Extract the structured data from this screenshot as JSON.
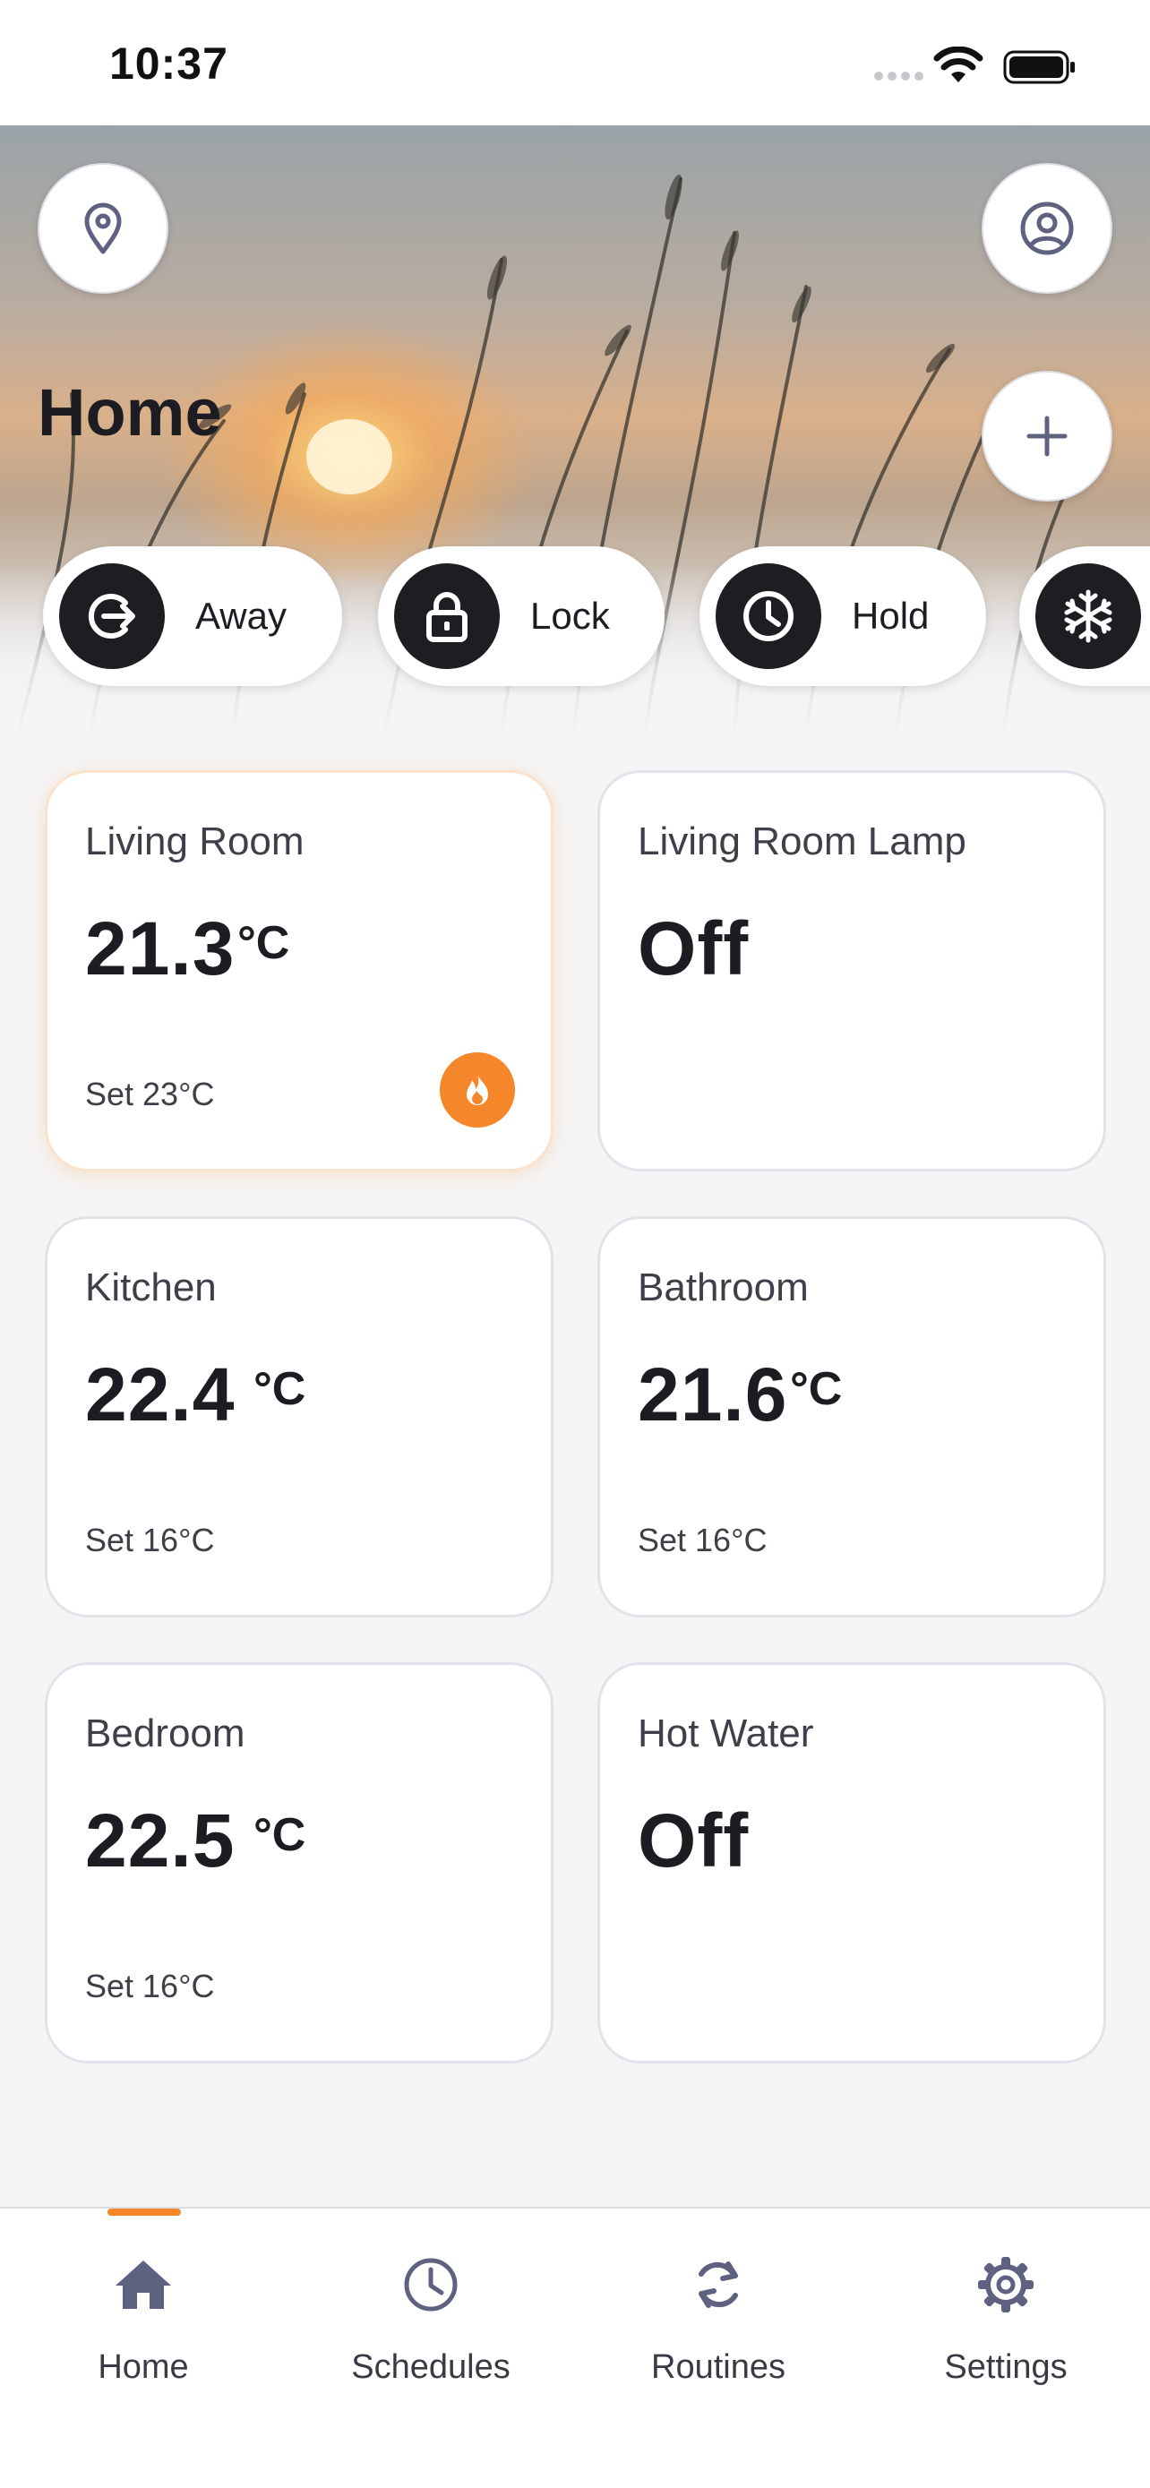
{
  "status_bar": {
    "time": "10:37"
  },
  "header": {
    "title": "Home",
    "location_icon": "location-pin-icon",
    "profile_icon": "user-circle-icon",
    "add_icon": "plus-icon"
  },
  "modes": [
    {
      "label": "Away",
      "icon": "exit-arrow-icon"
    },
    {
      "label": "Lock",
      "icon": "padlock-icon"
    },
    {
      "label": "Hold",
      "icon": "clock-icon"
    },
    {
      "label": "",
      "icon": "snowflake-icon"
    }
  ],
  "rooms": [
    {
      "name": "Living Room",
      "value": "21.3",
      "unit": "°C",
      "setpoint": "Set 23°C",
      "heating": true
    },
    {
      "name": "Living Room Lamp",
      "value": "Off",
      "unit": "",
      "setpoint": "",
      "heating": false
    },
    {
      "name": "Kitchen",
      "value": "22.4",
      "unit": "°C",
      "setpoint": "Set 16°C",
      "heating": false
    },
    {
      "name": "Bathroom",
      "value": "21.6",
      "unit": "°C",
      "setpoint": "Set 16°C",
      "heating": false
    },
    {
      "name": "Bedroom",
      "value": "22.5",
      "unit": "°C",
      "setpoint": "Set 16°C",
      "heating": false
    },
    {
      "name": "Hot Water",
      "value": "Off",
      "unit": "",
      "setpoint": "",
      "heating": false
    }
  ],
  "tabs": [
    {
      "label": "Home",
      "icon": "house-icon",
      "active": true
    },
    {
      "label": "Schedules",
      "icon": "clock-icon",
      "active": false
    },
    {
      "label": "Routines",
      "icon": "refresh-icon",
      "active": false
    },
    {
      "label": "Settings",
      "icon": "gear-icon",
      "active": false
    }
  ],
  "colors": {
    "accent": "#f5862a",
    "dark": "#1d1d22",
    "tab_icon": "#5e6280",
    "card_border": "#e2e2ea"
  }
}
